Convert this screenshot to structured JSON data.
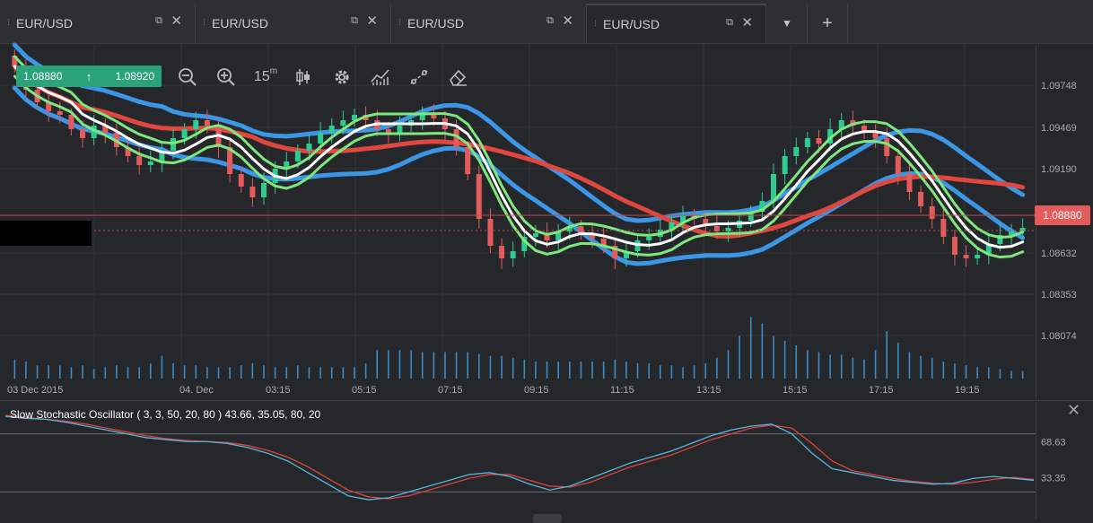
{
  "tabs": [
    {
      "label": "EUR/USD",
      "active": false
    },
    {
      "label": "EUR/USD",
      "active": false
    },
    {
      "label": "EUR/USD",
      "active": false
    },
    {
      "label": "EUR/USD",
      "active": true
    }
  ],
  "tab_icons": {
    "popout": "popout-icon",
    "close": "close-icon",
    "dropdown": "chevron-down-icon",
    "add": "plus-icon"
  },
  "quote": {
    "bid": "1.08880",
    "ask": "1.08920",
    "direction_icon": "arrow-up-icon"
  },
  "toolbar": {
    "tools": [
      "zoom-out-icon",
      "zoom-in-icon",
      "timeframe-icon",
      "candle-type-icon",
      "settings-icon",
      "indicators-icon",
      "drawing-icon",
      "eraser-icon"
    ],
    "timeframe_label": "15",
    "timeframe_unit": "m"
  },
  "current_price": "1.08880",
  "price_axis": [
    "1.09748",
    "1.09469",
    "1.09190",
    "1.08632",
    "1.08353",
    "1.08074"
  ],
  "time_axis": [
    "03 Dec 2015",
    "04. Dec",
    "03:15",
    "05:15",
    "07:15",
    "09:15",
    "11:15",
    "13:15",
    "15:15",
    "17:15",
    "19:15"
  ],
  "indicator": {
    "label": "Slow Stochastic Oscillator ( 3, 3, 50, 20, 80 ) 43.66, 35.05, 80, 20",
    "axis": [
      "68.63",
      "33.35"
    ]
  },
  "colors": {
    "bull": "#2ecc8f",
    "bear": "#e35b5b",
    "blue_band": "#3b96e6",
    "red_ma": "#e0483f",
    "green_band": "#7ee87e",
    "white_ma": "#ffffff",
    "volume": "#3a8bc9",
    "stoch_k": "#5ab6dc",
    "stoch_d": "#d9443d",
    "accent": "#2ba37a"
  },
  "chart_data": {
    "type": "candlestick",
    "symbol": "EUR/USD",
    "ylim": [
      1.079,
      1.099
    ],
    "closes": [
      1.0965,
      1.0952,
      1.0945,
      1.094,
      1.0938,
      1.093,
      1.0925,
      1.0932,
      1.0928,
      1.092,
      1.0915,
      1.091,
      1.0912,
      1.0918,
      1.0925,
      1.093,
      1.0935,
      1.0932,
      1.092,
      1.0905,
      1.0898,
      1.0892,
      1.09,
      1.0908,
      1.0912,
      1.0918,
      1.0922,
      1.0928,
      1.0932,
      1.0935,
      1.0938,
      1.0935,
      1.093,
      1.0928,
      1.0932,
      1.0935,
      1.0938,
      1.0936,
      1.093,
      1.092,
      1.0905,
      1.088,
      1.0865,
      1.0858,
      1.0862,
      1.087,
      1.0872,
      1.0868,
      1.0873,
      1.0876,
      1.0872,
      1.0869,
      1.0865,
      1.0858,
      1.0862,
      1.0868,
      1.087,
      1.0874,
      1.0878,
      1.0882,
      1.088,
      1.0876,
      1.0873,
      1.0875,
      1.0879,
      1.0884,
      1.089,
      1.0905,
      1.0915,
      1.092,
      1.0925,
      1.0922,
      1.093,
      1.0935,
      1.0932,
      1.0928,
      1.0925,
      1.0915,
      1.0905,
      1.0895,
      1.0887,
      1.088,
      1.087,
      1.086,
      1.0858,
      1.086,
      1.0866,
      1.0871,
      1.0873,
      1.0875
    ],
    "volume": [
      20,
      18,
      14,
      14,
      14,
      12,
      14,
      10,
      12,
      14,
      12,
      12,
      16,
      24,
      16,
      14,
      14,
      12,
      12,
      12,
      14,
      16,
      14,
      12,
      12,
      14,
      12,
      12,
      12,
      12,
      12,
      16,
      30,
      30,
      30,
      30,
      28,
      28,
      28,
      28,
      28,
      26,
      24,
      24,
      22,
      20,
      18,
      18,
      18,
      18,
      18,
      18,
      18,
      20,
      18,
      16,
      16,
      14,
      14,
      12,
      14,
      16,
      22,
      30,
      45,
      65,
      58,
      45,
      40,
      35,
      30,
      28,
      25,
      25,
      22,
      20,
      30,
      50,
      38,
      28,
      24,
      22,
      18,
      16,
      14,
      12,
      12,
      10,
      8,
      8
    ],
    "stochastic": {
      "k": [
        98,
        96,
        95,
        92,
        88,
        84,
        80,
        76,
        74,
        72,
        72,
        70,
        66,
        60,
        52,
        40,
        28,
        16,
        12,
        14,
        20,
        26,
        32,
        38,
        40,
        36,
        28,
        22,
        26,
        34,
        42,
        50,
        56,
        62,
        70,
        78,
        84,
        88,
        90,
        80,
        60,
        44,
        40,
        36,
        32,
        30,
        28,
        29,
        34,
        36,
        34,
        32
      ],
      "d": [
        99,
        97,
        95,
        93,
        90,
        86,
        82,
        78,
        75,
        73,
        72,
        71,
        68,
        63,
        56,
        46,
        34,
        22,
        15,
        13,
        16,
        22,
        28,
        34,
        38,
        38,
        32,
        26,
        25,
        30,
        38,
        46,
        52,
        58,
        66,
        74,
        80,
        86,
        89,
        86,
        70,
        52,
        42,
        38,
        34,
        31,
        29,
        28,
        30,
        33,
        35,
        33
      ],
      "upper": 80,
      "lower": 20
    }
  }
}
